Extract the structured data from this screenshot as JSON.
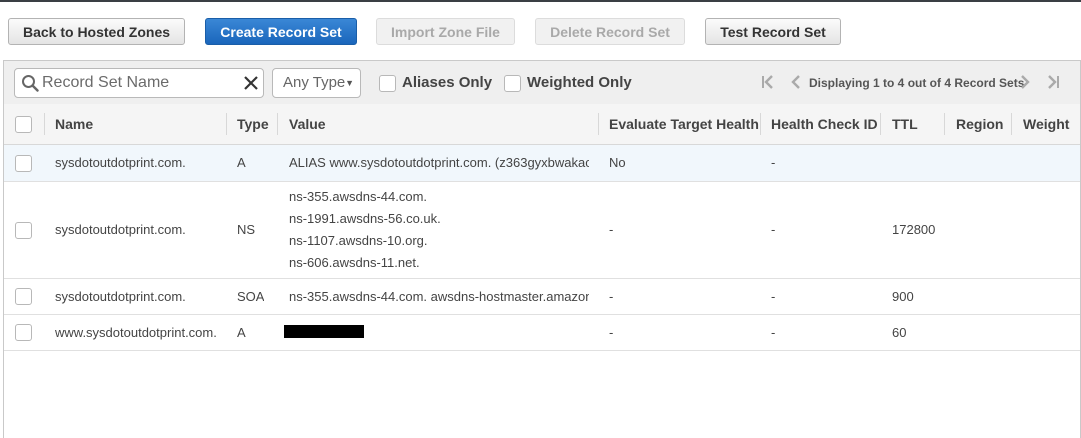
{
  "toolbar": {
    "back_label": "Back to Hosted Zones",
    "create_label": "Create Record Set",
    "import_label": "Import Zone File",
    "delete_label": "Delete Record Set",
    "test_label": "Test Record Set"
  },
  "filter": {
    "search_placeholder": "Record Set Name",
    "type_value": "Any Type",
    "aliases_label": "Aliases Only",
    "weighted_label": "Weighted Only",
    "pager_text": "Displaying 1 to 4 out of 4 Record Sets"
  },
  "table": {
    "headers": {
      "name": "Name",
      "type": "Type",
      "value": "Value",
      "eth": "Evaluate Target Health",
      "hc": "Health Check ID",
      "ttl": "TTL",
      "region": "Region",
      "weight": "Weight"
    },
    "rows": [
      {
        "name": "sysdotoutdotprint.com.",
        "type": "A",
        "values": [
          "ALIAS www.sysdotoutdotprint.com. (z363gyxbwakac"
        ],
        "eth": "No",
        "hc": "-",
        "ttl": ""
      },
      {
        "name": "sysdotoutdotprint.com.",
        "type": "NS",
        "values": [
          "ns-355.awsdns-44.com.",
          "ns-1991.awsdns-56.co.uk.",
          "ns-1107.awsdns-10.org.",
          "ns-606.awsdns-11.net."
        ],
        "eth": "-",
        "hc": "-",
        "ttl": "172800"
      },
      {
        "name": "sysdotoutdotprint.com.",
        "type": "SOA",
        "values": [
          "ns-355.awsdns-44.com. awsdns-hostmaster.amazon"
        ],
        "eth": "-",
        "hc": "-",
        "ttl": "900"
      },
      {
        "name": "www.sysdotoutdotprint.com.",
        "type": "A",
        "values": [],
        "eth": "-",
        "hc": "-",
        "ttl": "60"
      }
    ]
  }
}
